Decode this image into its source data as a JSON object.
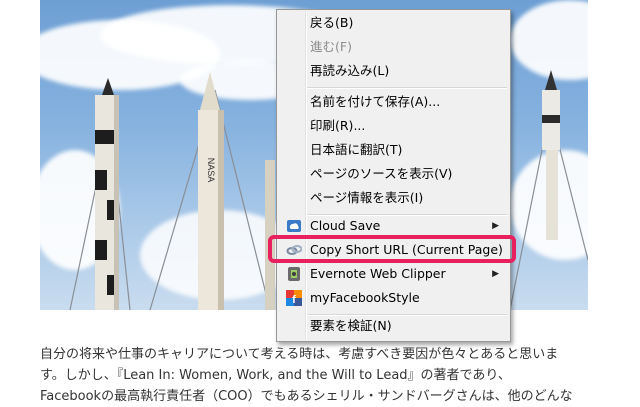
{
  "menu": {
    "items": [
      {
        "label": "戻る(B)",
        "disabled": false
      },
      {
        "label": "進む(F)",
        "disabled": true
      },
      {
        "label": "再読み込み(L)",
        "disabled": false
      },
      {
        "label": "名前を付けて保存(A)...",
        "disabled": false
      },
      {
        "label": "印刷(R)...",
        "disabled": false
      },
      {
        "label": "日本語に翻訳(T)",
        "disabled": false
      },
      {
        "label": "ページのソースを表示(V)",
        "disabled": false
      },
      {
        "label": "ページ情報を表示(I)",
        "disabled": false
      },
      {
        "label": "Cloud Save",
        "icon": "cloud-save-icon",
        "submenu": true
      },
      {
        "label": "Copy Short URL (Current Page)",
        "icon": "link-chain-icon",
        "highlighted": true
      },
      {
        "label": "Evernote Web Clipper",
        "icon": "evernote-icon",
        "submenu": true
      },
      {
        "label": "myFacebookStyle",
        "icon": "facebook-icon"
      },
      {
        "label": "要素を検証(N)",
        "disabled": false
      }
    ],
    "submenu_arrow": "▶"
  },
  "photo": {
    "rocket_text": "NASA"
  },
  "article": {
    "lines": [
      "自分の将来や仕事のキャリアについて考える時は、考慮すべき要因が色々とあると思いま",
      "す。しかし、『Lean In: Women, Work, and the Will to Lead』の著者であり、",
      "Facebookの最高執行責任者（COO）でもあるシェリル・サンドバーグさんは、他のどんな"
    ]
  },
  "colors": {
    "highlight_border": "#e8205e",
    "menu_background": "#f0f0f0",
    "sky": "#86b2df"
  }
}
